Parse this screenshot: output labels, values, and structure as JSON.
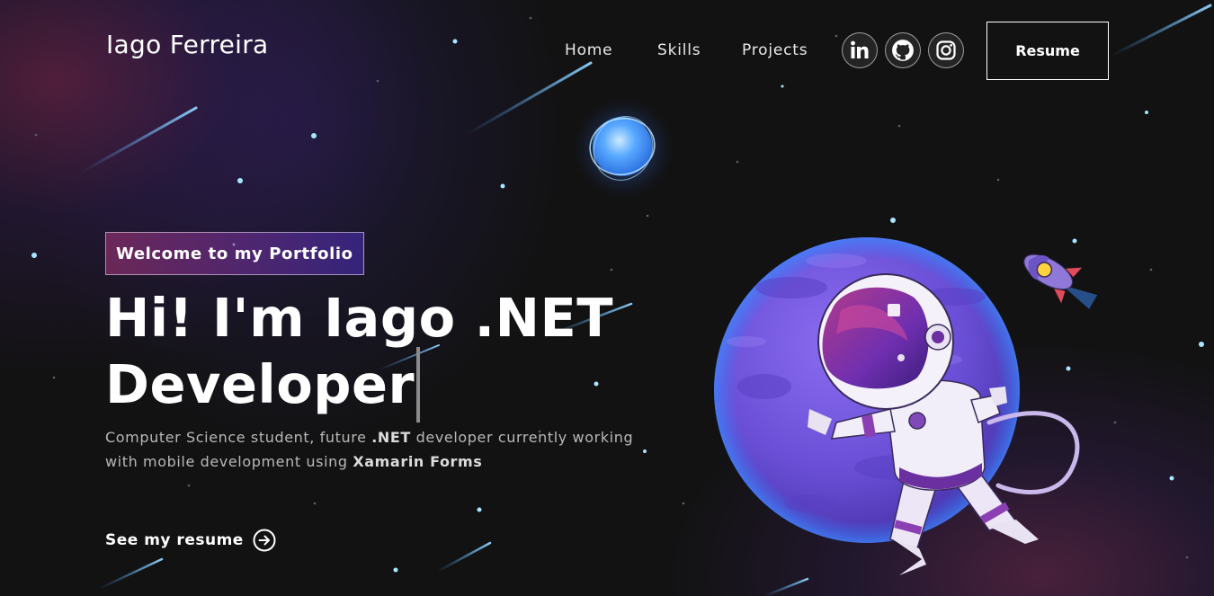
{
  "header": {
    "brand": "Iago Ferreira",
    "nav": [
      {
        "label": "Home"
      },
      {
        "label": "Skills"
      },
      {
        "label": "Projects"
      }
    ],
    "socials": [
      {
        "icon": "linkedin-icon"
      },
      {
        "icon": "github-icon"
      },
      {
        "icon": "instagram-icon"
      }
    ],
    "resume_label": "Resume"
  },
  "hero": {
    "tagline": "Welcome to my Portfolio",
    "headline_line1": "Hi! I'm Iago .NET",
    "headline_line2": "Developer",
    "description": {
      "part1": "Computer Science student, future ",
      "strong1": ".NET",
      "part2": " developer currently working with mobile development using ",
      "strong2": "Xamarin Forms"
    },
    "cta_label": "See my resume",
    "cta_icon": "arrow-right-circle-icon"
  },
  "illustration": {
    "items": [
      "astronaut",
      "planet",
      "rocket",
      "blue-star"
    ]
  },
  "colors": {
    "background": "#121212",
    "tagline_gradient_start": "#aa367c",
    "tagline_gradient_end": "#4a2fbd",
    "planet": "#6a4fd6",
    "star_dot": "#a8e6ff"
  }
}
